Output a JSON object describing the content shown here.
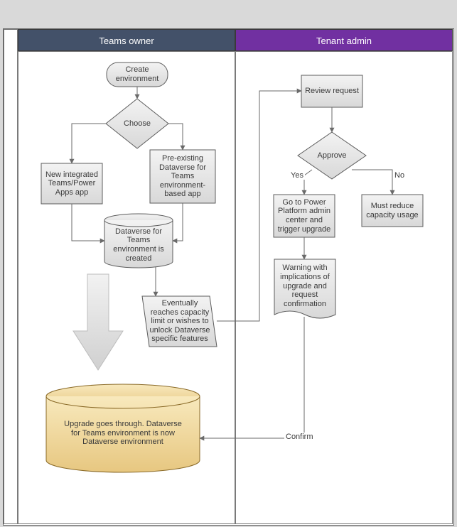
{
  "lanes": {
    "left": "Teams owner",
    "right": "Tenant admin"
  },
  "nodes": {
    "create": "Create environment",
    "choose": "Choose",
    "new_app": "New integrated Teams/Power Apps app",
    "pre_app": "Pre-existing Dataverse for Teams environment-based app",
    "created": "Dataverse for Teams environment is created",
    "capacity": "Eventually reaches capacity limit or wishes to unlock Dataverse specific features",
    "upgrade": "Upgrade goes through. Dataverse for Teams environment is now Dataverse environment",
    "review": "Review request",
    "approve": "Approve",
    "go_admin": "Go to Power Platform admin center and trigger upgrade",
    "reduce": "Must reduce capacity usage",
    "warning": "Warning with implications of upgrade and request confirmation"
  },
  "edges": {
    "yes": "Yes",
    "no": "No",
    "confirm": "Confirm"
  },
  "colors": {
    "lane_owner": "#435169",
    "lane_admin": "#7130a1",
    "node_fill": "#e9e9e9",
    "node_stroke": "#5c5c5c",
    "upgrade_fill": "#f0daa0",
    "upgrade_stroke": "#8a6a28"
  }
}
